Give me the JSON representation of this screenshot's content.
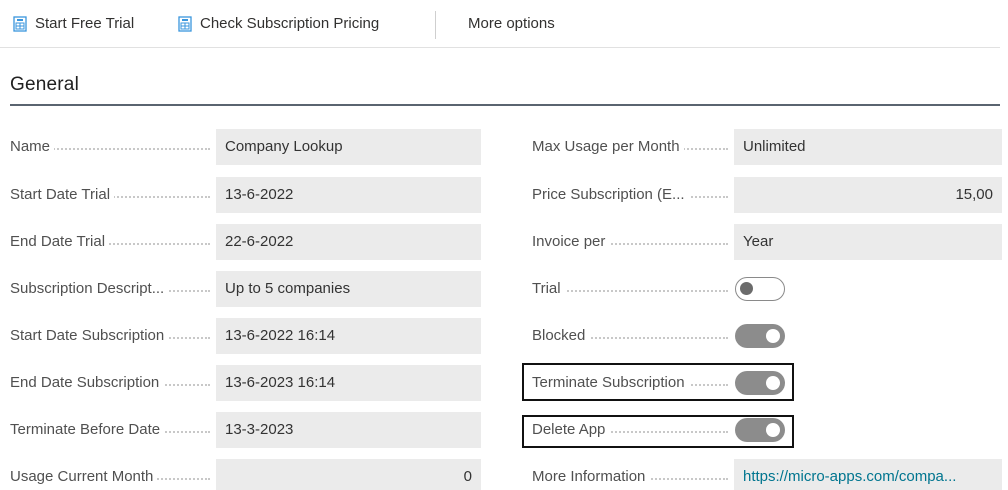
{
  "actions": {
    "start_trial": "Start Free Trial",
    "check_pricing": "Check Subscription Pricing",
    "more_options": "More options",
    "icon_color": "#3a96dd"
  },
  "section": {
    "title": "General"
  },
  "left_fields": [
    {
      "label": "Name",
      "value": "Company Lookup"
    },
    {
      "label": "Start Date Trial",
      "value": "13-6-2022"
    },
    {
      "label": "End Date Trial",
      "value": "22-6-2022"
    },
    {
      "label": "Subscription Descript...",
      "value": "Up to 5 companies"
    },
    {
      "label": "Start Date Subscription",
      "value": "13-6-2022 16:14"
    },
    {
      "label": "End Date Subscription",
      "value": "13-6-2023 16:14"
    },
    {
      "label": "Terminate Before Date",
      "value": "13-3-2023"
    },
    {
      "label": "Usage Current Month",
      "value": "0"
    }
  ],
  "right_fields": {
    "max_usage": {
      "label": "Max Usage per Month",
      "value": "Unlimited"
    },
    "price": {
      "label": "Price Subscription (E...",
      "value": "15,00"
    },
    "invoice_per": {
      "label": "Invoice per",
      "value": "Year"
    },
    "trial": {
      "label": "Trial",
      "value": false
    },
    "blocked": {
      "label": "Blocked",
      "value": true
    },
    "terminate": {
      "label": "Terminate Subscription",
      "value": true
    },
    "delete_app": {
      "label": "Delete App",
      "value": true
    },
    "more_info": {
      "label": "More Information",
      "value": "https://micro-apps.com/compa..."
    }
  }
}
